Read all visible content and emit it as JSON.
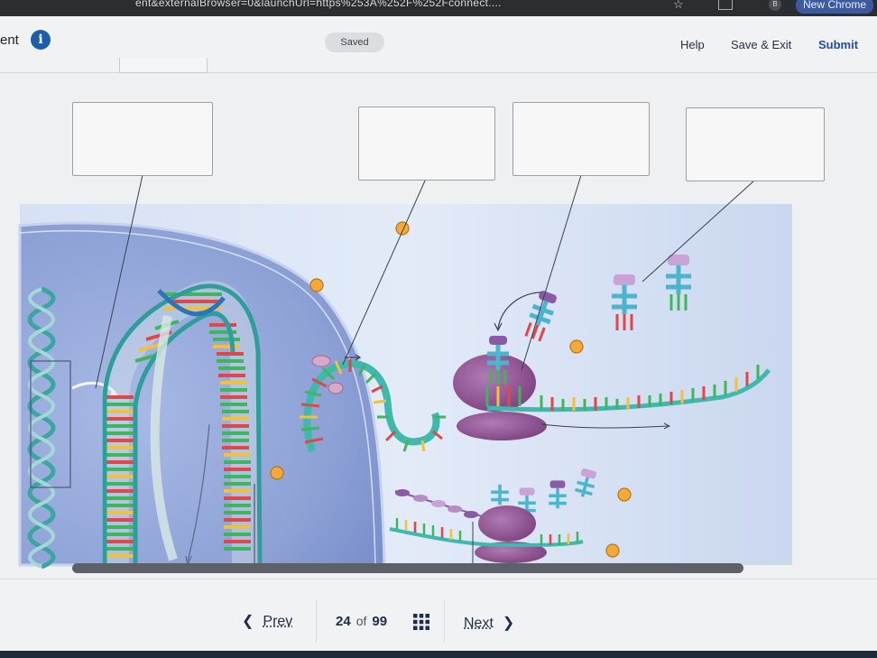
{
  "browser": {
    "url_fragment": "ent&externalBrowser=0&launchUrl=https%253A%252F%252Fconnect....",
    "new_chrome_label": "New Chrome",
    "profile_initial": "B"
  },
  "header": {
    "assignment_label": "ent",
    "save_status": "Saved",
    "help_label": "Help",
    "save_exit_label": "Save & Exit",
    "submit_label": "Submit"
  },
  "footer": {
    "prev_label": "Prev",
    "current_page": "24",
    "of_label": "of",
    "total_pages": "99",
    "next_label": "Next"
  },
  "drop_targets": [
    "",
    "",
    "",
    ""
  ],
  "colors": {
    "nucleus": "#8ea4d8",
    "cytoplasm": "#cfdcf2",
    "ribosome": "#8a4c8c",
    "accent_link": "#1f4ea6",
    "info_icon": "#1d5ea8"
  }
}
